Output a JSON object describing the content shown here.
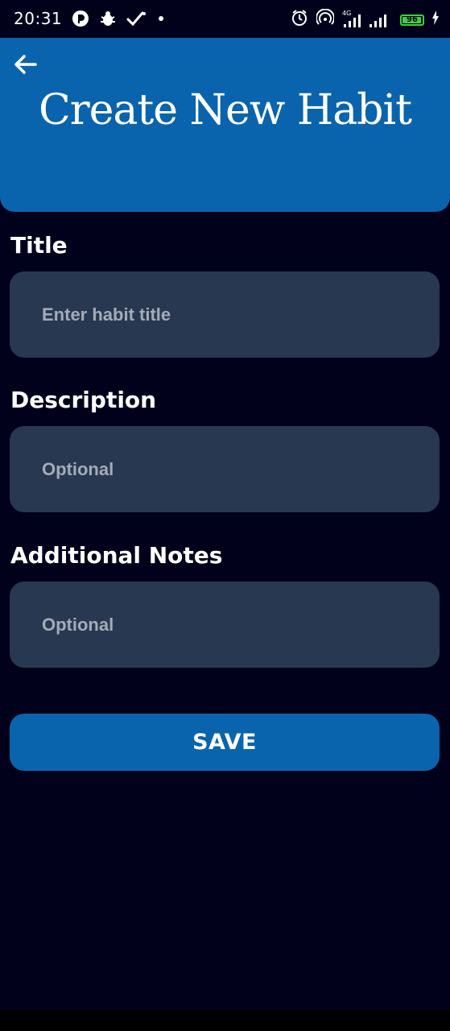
{
  "status_bar": {
    "time": "20:31",
    "network": "4G",
    "battery_level": "96",
    "battery_fraction": 0.96
  },
  "header": {
    "title": "Create New Habit",
    "back_icon": "arrow-left-icon"
  },
  "form": {
    "title": {
      "label": "Title",
      "placeholder": "Enter habit title",
      "value": ""
    },
    "description": {
      "label": "Description",
      "placeholder": "Optional",
      "value": ""
    },
    "notes": {
      "label": "Additional Notes",
      "placeholder": "Optional",
      "value": ""
    },
    "save_label": "SAVE"
  },
  "colors": {
    "background": "#01011c",
    "primary": "#0a64ad",
    "input_background": "#283850",
    "placeholder": "#a3acb8",
    "battery": "#3fd13f"
  }
}
